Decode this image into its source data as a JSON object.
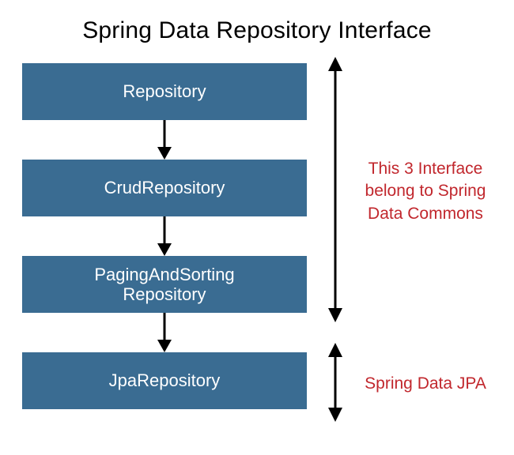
{
  "title": "Spring Data Repository Interface",
  "boxes": {
    "b1": "Repository",
    "b2": "CrudRepository",
    "b3": "PagingAndSorting Repository",
    "b4": "JpaRepository"
  },
  "annotations": {
    "commons": "This 3 Interface belong to Spring Data Commons",
    "jpa": "Spring Data JPA"
  }
}
